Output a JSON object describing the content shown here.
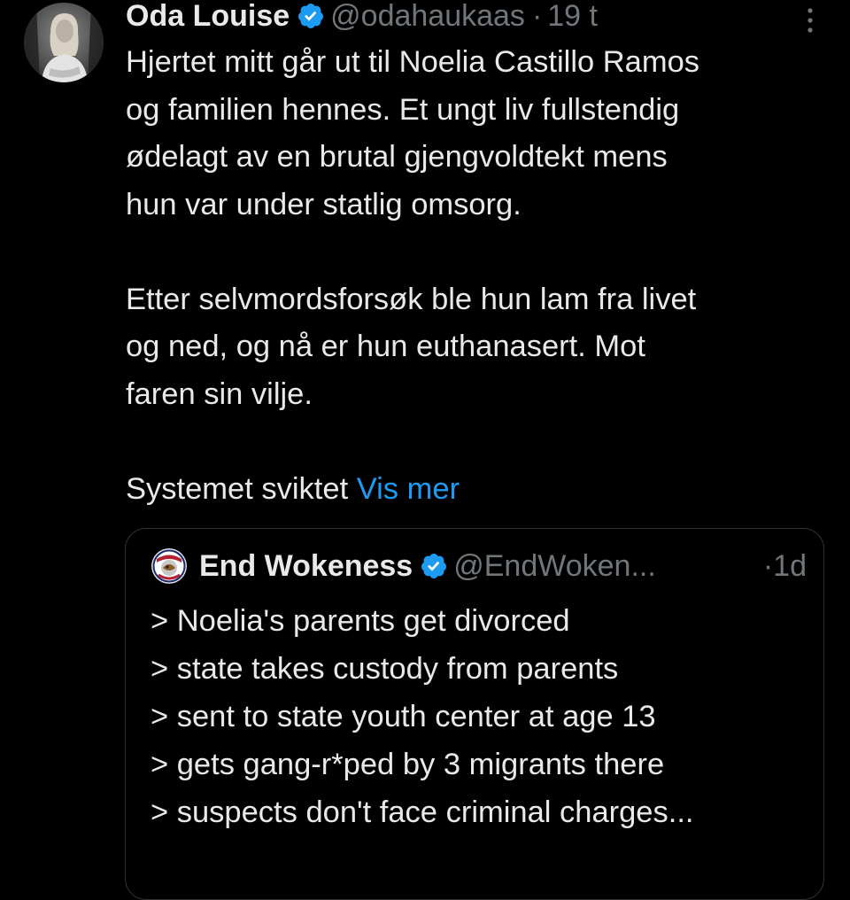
{
  "post": {
    "author_name": "Oda Louise",
    "handle": "@odahaukaas",
    "separator": "·",
    "time": "19 t",
    "verified_color": "#1d9bf0",
    "more_icon": "more-vertical-icon",
    "paragraphs": [
      [
        "Hjertet mitt går ut til Noelia Castillo Ramos",
        "og familien hennes. Et ungt liv fullstendig",
        "ødelagt av en brutal gjengvoldtekt mens",
        "hun var under statlig omsorg."
      ],
      [
        "Etter selvmordsforsøk ble hun lam fra livet",
        "og ned, og nå er hun euthanasert. Mot",
        "faren sin vilje."
      ]
    ],
    "last_line": "Systemet sviktet",
    "show_more": "Vis mer"
  },
  "quote": {
    "author_name": "End Wokeness",
    "handle": "@EndWoken...",
    "separator": "·",
    "time": "1d",
    "lines": [
      "> Noelia's parents get divorced",
      "> state takes custody from parents",
      "> sent to state youth center at age 13",
      "> gets gang-r*ped by 3 migrants there",
      "> suspects don't face criminal charges..."
    ]
  },
  "colors": {
    "background": "#000000",
    "text": "#e7e9ea",
    "secondary": "#71767b",
    "link": "#1d9bf0",
    "border": "#2f3336"
  }
}
